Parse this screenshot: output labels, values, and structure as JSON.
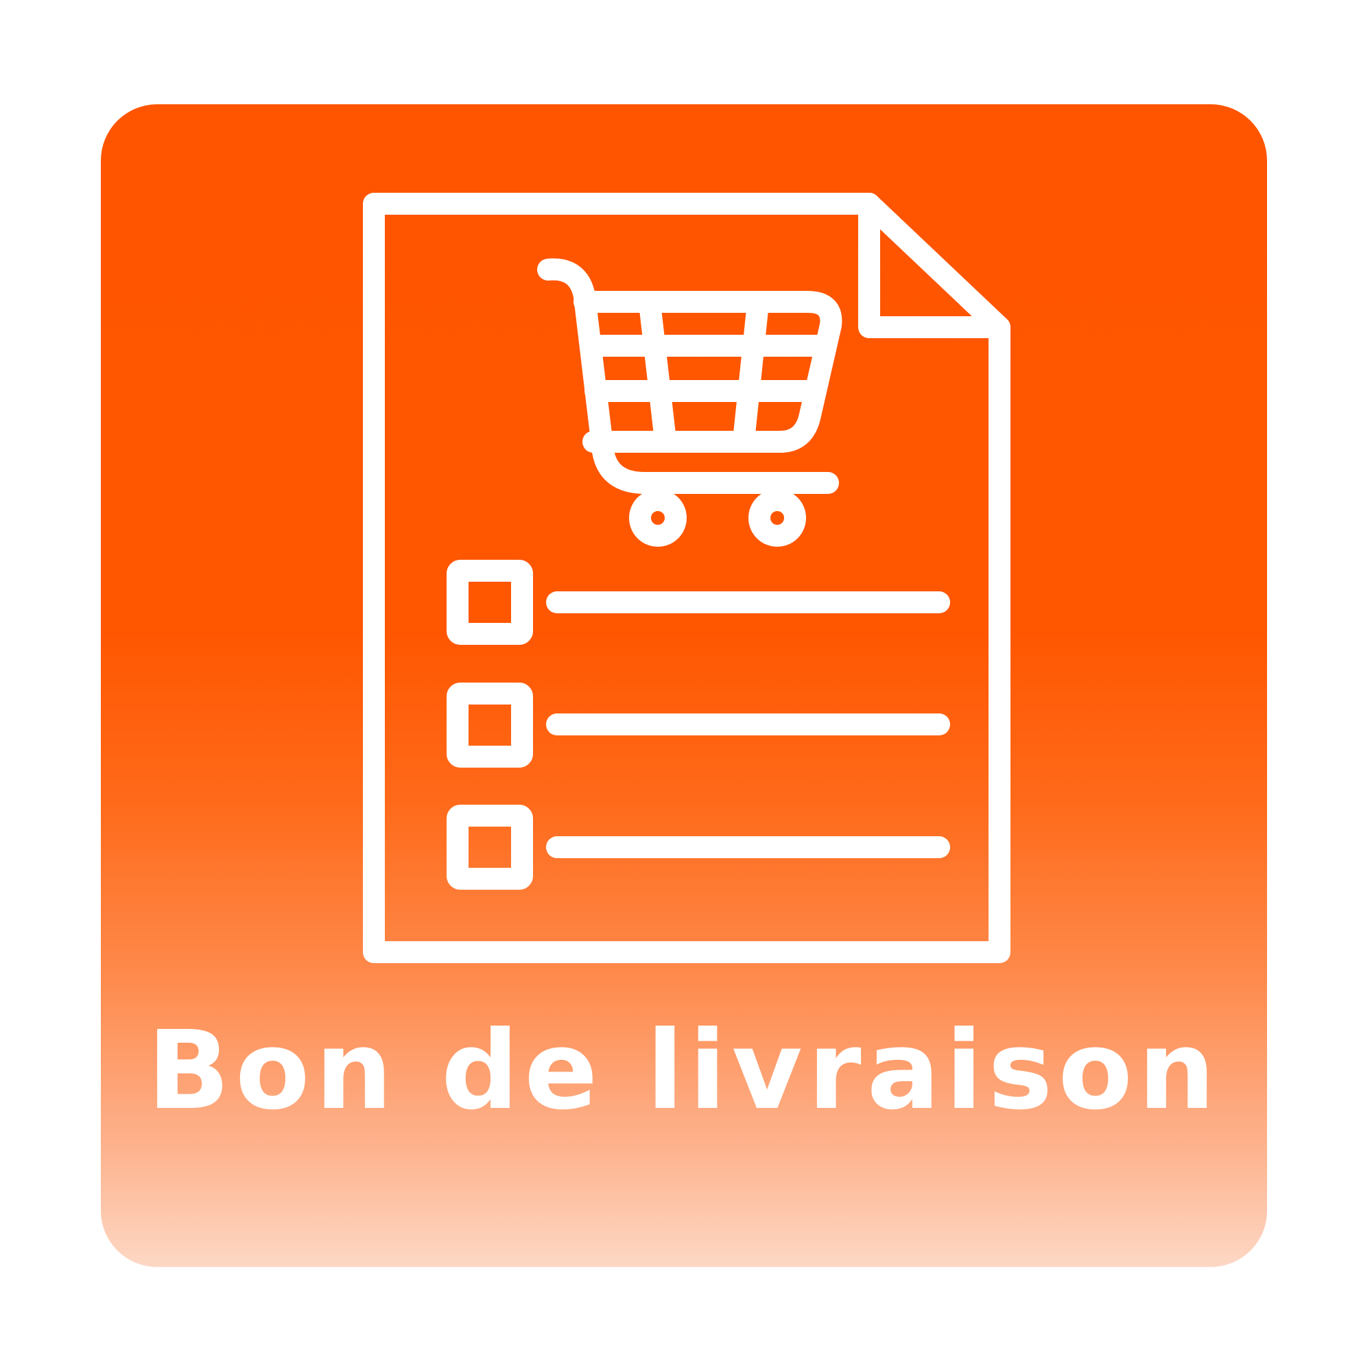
{
  "tile": {
    "label": "Bon de livraison",
    "icon": "delivery-note-cart-checklist-icon",
    "colors": {
      "gradient_top": "#ff5500",
      "gradient_bottom": "#fdd8c5",
      "foreground": "#ffffff",
      "background": "#ffffff"
    },
    "checklist_rows": 3
  }
}
